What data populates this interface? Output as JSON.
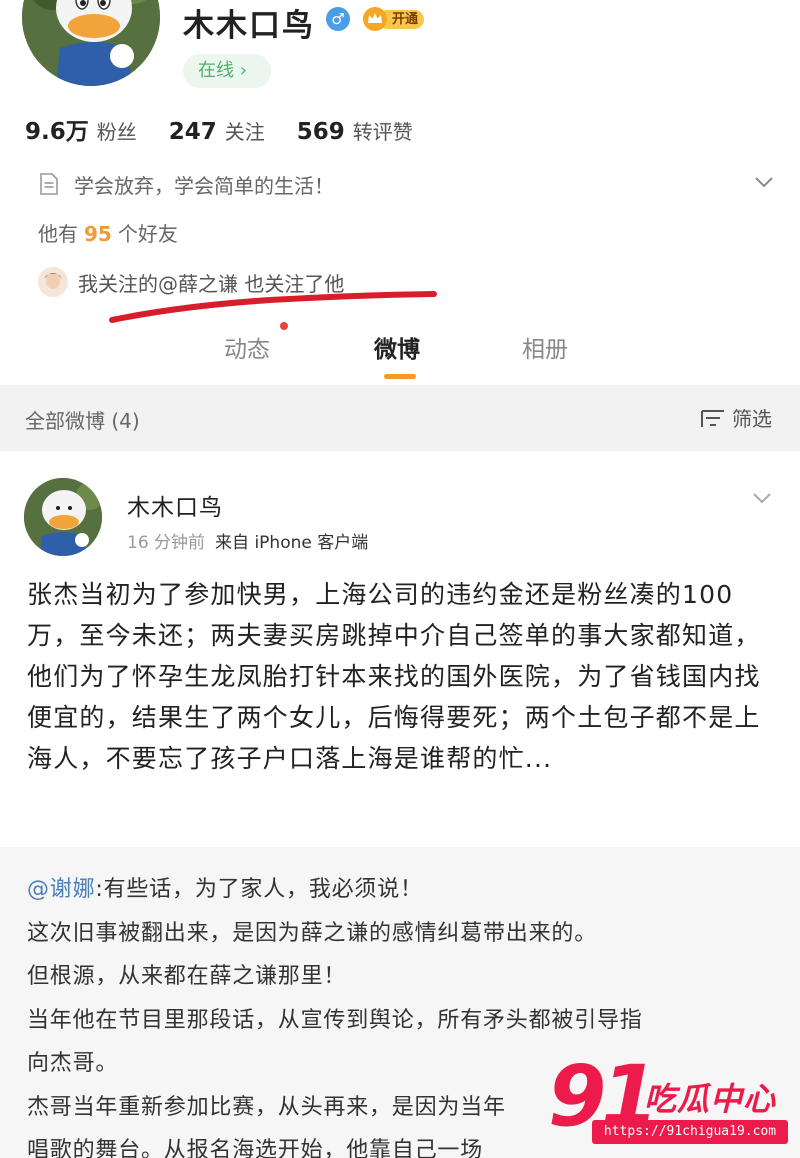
{
  "profile": {
    "name": "木木口鸟",
    "gender_symbol": "♂",
    "vip_label": "开通",
    "online_label": "在线 ›",
    "stats": [
      {
        "num": "9.6万",
        "label": "粉丝"
      },
      {
        "num": "247",
        "label": "关注"
      },
      {
        "num": "569",
        "label": "转评赞"
      }
    ],
    "bio": "学会放弃，学会简单的生活！",
    "friends_prefix": "他有",
    "friends_count": "95",
    "friends_suffix": "个好友",
    "mutual_text": "我关注的@薛之谦 也关注了他"
  },
  "tabs": [
    {
      "label": "动态"
    },
    {
      "label": "微博"
    },
    {
      "label": "相册"
    }
  ],
  "filter": {
    "title": "全部微博 (4)",
    "button_label": "筛选"
  },
  "post": {
    "author": "木木口鸟",
    "time": "16 分钟前",
    "source": "来自 iPhone 客户端",
    "body": "张杰当初为了参加快男，上海公司的违约金还是粉丝凑的100万，至今未还；两夫妻买房跳掉中介自己签单的事大家都知道，他们为了怀孕生龙凤胎打针本来找的国外医院，为了省钱国内找便宜的，结果生了两个女儿，后悔得要死；两个土包子都不是上海人，不要忘了孩子户口落上海是谁帮的忙...",
    "repost": {
      "mention": "@谢娜",
      "lines": [
        ":有些话，为了家人，我必须说！",
        "这次旧事被翻出来，是因为薛之谦的感情纠葛带出来的。",
        "但根源，从来都在薛之谦那里！",
        "当年他在节目里那段话，从宣传到舆论，所有矛头都被引导指",
        "向杰哥。",
        "杰哥当年重新参加比赛，从头再来，是因为当年",
        "唱歌的舞台。从报名海选开始，他靠自己一场"
      ]
    }
  },
  "watermark": {
    "big": "91",
    "text": "吃瓜中心",
    "url": "https://91chigua19.com"
  },
  "colors": {
    "accent_orange": "#f39a2b",
    "friend_count": "#f19a38",
    "online_green": "#4fb26a",
    "mention_blue": "#4a7fb8",
    "annotation_red": "#d81e2a",
    "watermark_red": "#ec1b4b"
  }
}
